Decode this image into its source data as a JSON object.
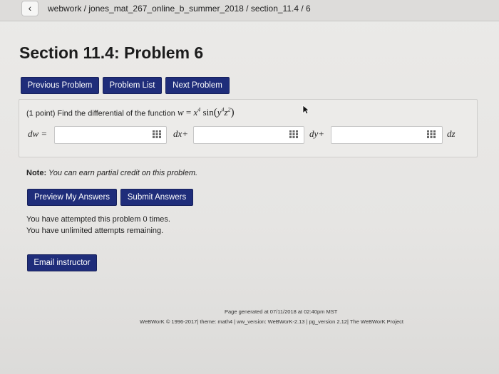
{
  "breadcrumb": "webwork / jones_mat_267_online_b_summer_2018 / section_11.4 / 6",
  "back_glyph": "‹",
  "page_title": "Section 11.4: Problem 6",
  "nav": {
    "previous": "Previous Problem",
    "list": "Problem List",
    "next": "Next Problem"
  },
  "problem": {
    "points": "(1 point) Find the differential of the function",
    "lhs": "w",
    "eq": " = ",
    "x": "x",
    "x_exp": "4",
    "sin": " sin",
    "y": "y",
    "y_exp": "4",
    "z": "z",
    "z_exp": "2"
  },
  "answer": {
    "lhs": "dw =",
    "dx": "dx+",
    "dy": "dy+",
    "dz": "dz",
    "values": [
      "",
      "",
      ""
    ]
  },
  "note": {
    "label": "Note:",
    "text": " You can earn partial credit on this problem."
  },
  "actions": {
    "preview": "Preview My Answers",
    "submit": "Submit Answers"
  },
  "attempts": {
    "line1": "You have attempted this problem 0 times.",
    "line2": "You have unlimited attempts remaining."
  },
  "email_button": "Email instructor",
  "footer": {
    "generated": "Page generated at 07/11/2018 at 02:40pm MST",
    "credits": "WeBWorK © 1996-2017| theme: math4 | ww_version: WeBWorK-2.13 | pg_version 2.12| The WeBWorK Project"
  },
  "colors": {
    "button": "#1f2d7a",
    "background": "#e6e5e3"
  }
}
